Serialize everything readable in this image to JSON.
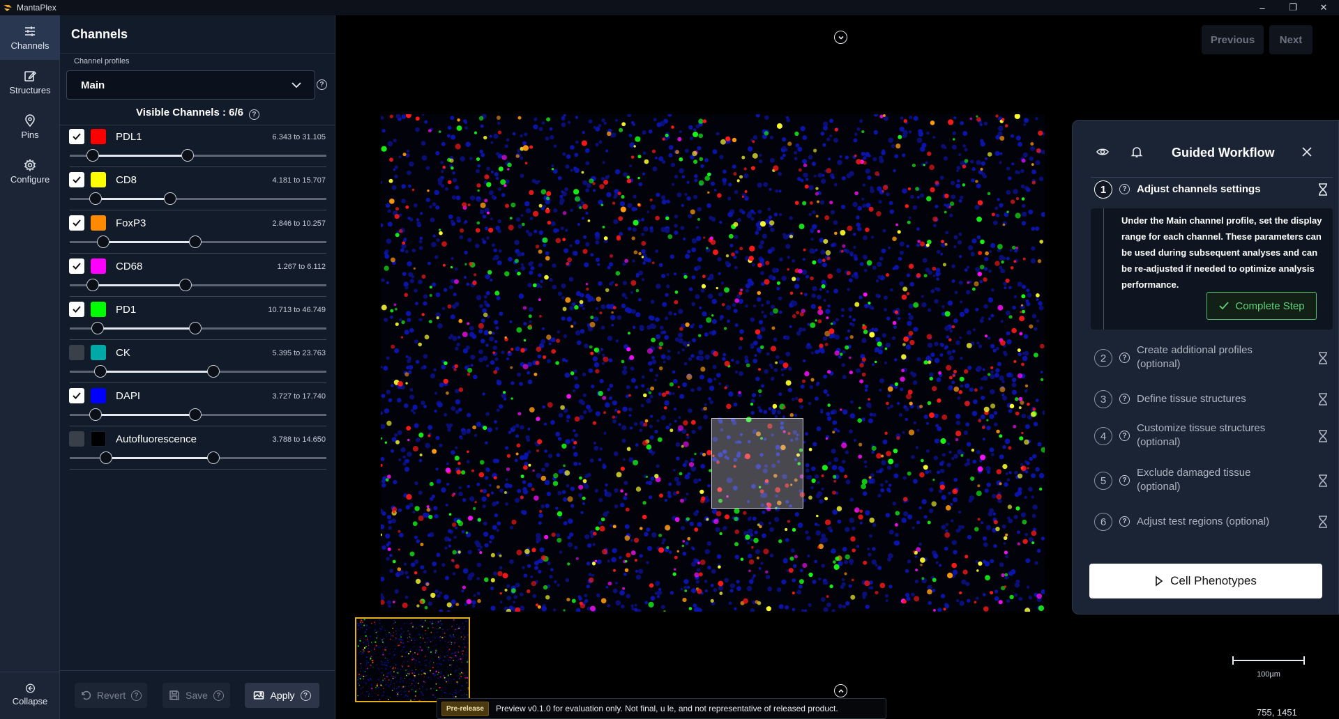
{
  "app": {
    "title": "MantaPlex"
  },
  "rail": {
    "items": [
      {
        "label": "Channels",
        "icon": "sliders-icon",
        "active": true
      },
      {
        "label": "Structures",
        "icon": "edit-icon"
      },
      {
        "label": "Pins",
        "icon": "pin-icon"
      },
      {
        "label": "Configure",
        "icon": "gear-icon"
      }
    ],
    "collapse_label": "Collapse"
  },
  "channels_panel": {
    "title": "Channels",
    "profiles_label": "Channel profiles",
    "profile_selected": "Main",
    "visible_channels": "Visible Channels : 6/6",
    "channels": [
      {
        "name": "PDL1",
        "color": "#ff0000",
        "checked": true,
        "range": "6.343 to 31.105",
        "low": 0.09,
        "high": 0.46
      },
      {
        "name": "CD8",
        "color": "#ffff00",
        "checked": true,
        "range": "4.181 to 15.707",
        "low": 0.1,
        "high": 0.39
      },
      {
        "name": "FoxP3",
        "color": "#ff8a00",
        "checked": true,
        "range": "2.846 to 10.257",
        "low": 0.13,
        "high": 0.49
      },
      {
        "name": "CD68",
        "color": "#ff00ff",
        "checked": true,
        "range": "1.267 to 6.112",
        "low": 0.09,
        "high": 0.45
      },
      {
        "name": "PD1",
        "color": "#00ff00",
        "checked": true,
        "range": "10.713 to 46.749",
        "low": 0.11,
        "high": 0.49
      },
      {
        "name": "CK",
        "color": "#00a8a8",
        "checked": false,
        "range": "5.395 to 23.763",
        "low": 0.12,
        "high": 0.56
      },
      {
        "name": "DAPI",
        "color": "#0000ff",
        "checked": true,
        "range": "3.727 to 17.740",
        "low": 0.1,
        "high": 0.49
      },
      {
        "name": "Autofluorescence",
        "color": "#000000",
        "checked": false,
        "range": "3.788 to 14.650",
        "low": 0.14,
        "high": 0.56
      }
    ],
    "footer": {
      "revert": "Revert",
      "save": "Save",
      "apply": "Apply"
    }
  },
  "viewer": {
    "previous": "Previous",
    "next": "Next",
    "scale_label": "100µm",
    "coords": "755, 1451",
    "prerelease_tag": "Pre-release",
    "prerelease_text": "Preview v0.1.0 for evaluation only. Not final, u     le, and not representative of released product."
  },
  "workflow": {
    "title": "Guided Workflow",
    "steps": [
      {
        "num": "1",
        "label": "Adjust channels settings",
        "active": true
      },
      {
        "num": "2",
        "label": "Create additional profiles (optional)"
      },
      {
        "num": "3",
        "label": "Define tissue structures"
      },
      {
        "num": "4",
        "label": "Customize tissue structures (optional)"
      },
      {
        "num": "5",
        "label": "Exclude damaged tissue (optional)"
      },
      {
        "num": "6",
        "label": "Adjust test regions (optional)"
      }
    ],
    "step1_detail": "Under the Main channel profile, set the display range for each channel. These parameters can be used during subsequent analyses and can be re-adjusted if needed to optimize analysis performance.",
    "complete_step": "Complete Step",
    "phenotypes_button": "Cell Phenotypes"
  }
}
